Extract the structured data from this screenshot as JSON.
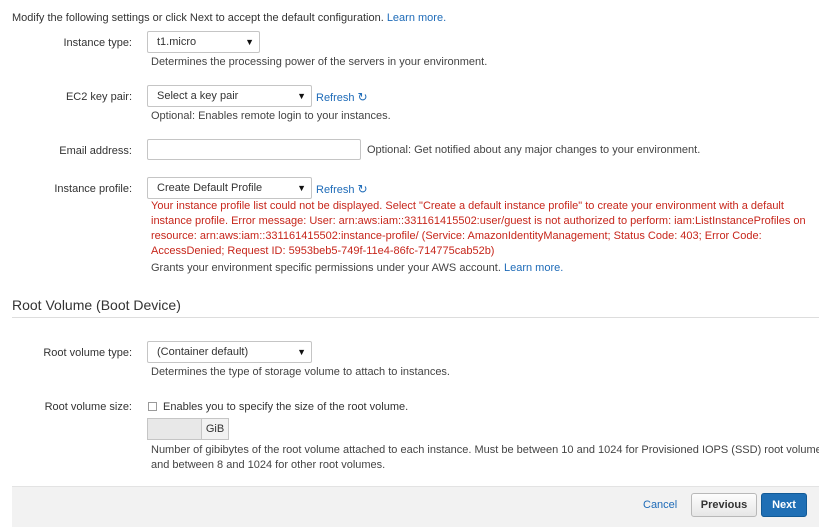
{
  "intro": {
    "text": "Modify the following settings or click Next to accept the default configuration.",
    "link": "Learn more."
  },
  "instance_type": {
    "label": "Instance type:",
    "value": "t1.micro",
    "help": "Determines the processing power of the servers in your environment."
  },
  "key_pair": {
    "label": "EC2 key pair:",
    "value": "Select a key pair",
    "refresh": "Refresh",
    "help": "Optional: Enables remote login to your instances."
  },
  "email": {
    "label": "Email address:",
    "value": "",
    "help": "Optional: Get notified about any major changes to your environment."
  },
  "instance_profile": {
    "label": "Instance profile:",
    "value": "Create Default Profile",
    "refresh": "Refresh",
    "error": "Your instance profile list could not be displayed. Select \"Create a default instance profile\" to create your environment with a default instance profile. Error message: User: arn:aws:iam::331161415502:user/guest is not authorized to perform: iam:ListInstanceProfiles on resource: arn:aws:iam::331161415502:instance-profile/ (Service: AmazonIdentityManagement; Status Code: 403; Error Code: AccessDenied; Request ID: 5953beb5-749f-11e4-86fc-714775cab52b)",
    "help": "Grants your environment specific permissions under your AWS account.",
    "link": "Learn more."
  },
  "root_volume": {
    "section_title": "Root Volume (Boot Device)",
    "type_label": "Root volume type:",
    "type_value": "(Container default)",
    "type_help": "Determines the type of storage volume to attach to instances.",
    "size_label": "Root volume size:",
    "size_checkbox_label": "Enables you to specify the size of the root volume.",
    "size_checked": false,
    "size_unit": "GiB",
    "size_help_line1": "Number of gibibytes of the root volume attached to each instance. Must be between 10 and 1024 for Provisioned IOPS (SSD) root volumes",
    "size_help_line2": "and between 8 and 1024 for other root volumes."
  },
  "footer": {
    "cancel": "Cancel",
    "previous": "Previous",
    "next": "Next"
  },
  "colors": {
    "link": "#1e6bb8",
    "error": "#c7261b",
    "primary_button": "#1f6fb5"
  }
}
